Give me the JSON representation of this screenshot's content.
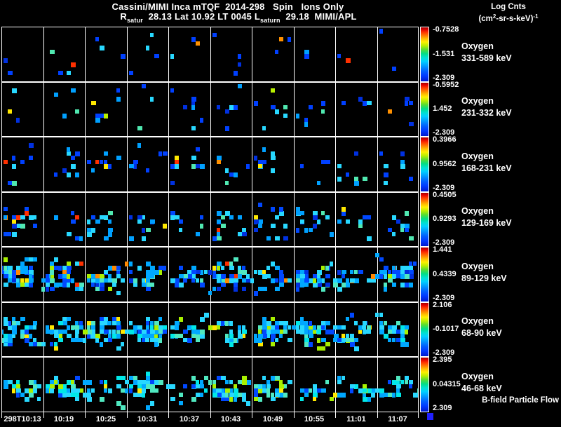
{
  "chart_data": {
    "type": "heatmap",
    "title": "Cassini/MIMI Inca mTQF  2014-298   Spin   Ions Only",
    "subtitle_parts": {
      "r": "R",
      "r_sub": "satur",
      "seg1": "  28.13 Lat 10.92 LT 0045 L",
      "l_sub": "saturn",
      "seg2": "  29.18  MIMI/APL"
    },
    "legend": {
      "title": "Log Cnts",
      "units_pre": "(cm",
      "units_sup_a": "2",
      "units_mid": "-sr-s-keV)",
      "units_sup_b": "-1"
    },
    "x_ticks": [
      "298T10:13",
      "10:19",
      "10:25",
      "10:31",
      "10:37",
      "10:43",
      "10:49",
      "10:55",
      "11:01",
      "11:07"
    ],
    "bfield_note": "B-field Particle Flow",
    "seed": 20142981,
    "colorbar_colors_top_to_bottom": [
      "#e00000",
      "#ff7700",
      "#fff000",
      "#58dd30",
      "#00e0d0",
      "#0098ff",
      "#0018cc"
    ],
    "panels": [
      {
        "species": "Oxygen",
        "energy": "331-589 keV",
        "cb_labels": [
          "-0.7528",
          "-1.531",
          "-2.309"
        ],
        "density": 30,
        "band_center": 0.45,
        "band_spread": 0.85,
        "palette": [
          [
            "#0040ff",
            38
          ],
          [
            "#0030e0",
            15
          ],
          [
            "#00a0ff",
            15
          ],
          [
            "#28d8ff",
            12
          ],
          [
            "#50e8b0",
            6
          ],
          [
            "#ffe800",
            5
          ],
          [
            "#ff9000",
            5
          ],
          [
            "#ff3000",
            4
          ]
        ]
      },
      {
        "species": "Oxygen",
        "energy": "231-332 keV",
        "cb_labels": [
          "-0.5952",
          "1.452",
          "-2.309"
        ],
        "density": 52,
        "band_center": 0.5,
        "band_spread": 0.8,
        "palette": [
          [
            "#0040ff",
            32
          ],
          [
            "#0030e0",
            12
          ],
          [
            "#00a0ff",
            20
          ],
          [
            "#28d8ff",
            18
          ],
          [
            "#50e8b0",
            8
          ],
          [
            "#b8f000",
            4
          ],
          [
            "#ff9000",
            3
          ],
          [
            "#ffe800",
            3
          ]
        ]
      },
      {
        "species": "Oxygen",
        "energy": "168-231 keV",
        "cb_labels": [
          "0.3966",
          "0.9562",
          "-2.309"
        ],
        "density": 88,
        "band_center": 0.55,
        "band_spread": 0.7,
        "palette": [
          [
            "#0040ff",
            30
          ],
          [
            "#00a0ff",
            22
          ],
          [
            "#28d8ff",
            20
          ],
          [
            "#0030e0",
            10
          ],
          [
            "#50e8b0",
            8
          ],
          [
            "#ffe800",
            4
          ],
          [
            "#ff9000",
            3
          ],
          [
            "#ff3000",
            3
          ]
        ]
      },
      {
        "species": "Oxygen",
        "energy": "129-169 keV",
        "cb_labels": [
          "0.4505",
          "0.9293",
          "-2.309"
        ],
        "density": 135,
        "band_center": 0.6,
        "band_spread": 0.55,
        "palette": [
          [
            "#0048ff",
            26
          ],
          [
            "#00a0ff",
            22
          ],
          [
            "#28d8ff",
            24
          ],
          [
            "#0030e0",
            8
          ],
          [
            "#50e8b0",
            10
          ],
          [
            "#ffe800",
            4
          ],
          [
            "#ff9000",
            3
          ],
          [
            "#ff3000",
            3
          ]
        ]
      },
      {
        "species": "Oxygen",
        "energy": "89-129 keV",
        "cb_labels": [
          "1.441",
          "0.4339",
          "-2.309"
        ],
        "density": 270,
        "band_center": 0.55,
        "band_spread": 0.42,
        "palette": [
          [
            "#00a8ff",
            26
          ],
          [
            "#28d8ff",
            24
          ],
          [
            "#0048ff",
            22
          ],
          [
            "#0030e0",
            8
          ],
          [
            "#50e8c0",
            10
          ],
          [
            "#a8f000",
            4
          ],
          [
            "#ffe800",
            3
          ],
          [
            "#ff8800",
            2
          ],
          [
            "#ff3000",
            1
          ]
        ]
      },
      {
        "species": "Oxygen",
        "energy": "68-90 keV",
        "cb_labels": [
          "2.106",
          "-0.1017",
          "-2.309"
        ],
        "density": 290,
        "band_center": 0.55,
        "band_spread": 0.44,
        "palette": [
          [
            "#28d8ff",
            28
          ],
          [
            "#00a8ff",
            26
          ],
          [
            "#0048ff",
            16
          ],
          [
            "#50e8c0",
            14
          ],
          [
            "#00e8e8",
            8
          ],
          [
            "#a8f000",
            5
          ],
          [
            "#ffe800",
            3
          ]
        ]
      },
      {
        "species": "Oxygen",
        "energy": "46-68 keV",
        "cb_labels": [
          "2.395",
          "0.04315",
          "2.309"
        ],
        "density": 240,
        "band_center": 0.58,
        "band_spread": 0.4,
        "palette": [
          [
            "#28d8ff",
            28
          ],
          [
            "#00a8ff",
            22
          ],
          [
            "#50e8c0",
            16
          ],
          [
            "#00e8e8",
            12
          ],
          [
            "#0048ff",
            10
          ],
          [
            "#a8f000",
            7
          ],
          [
            "#ffe800",
            5
          ]
        ]
      }
    ]
  }
}
